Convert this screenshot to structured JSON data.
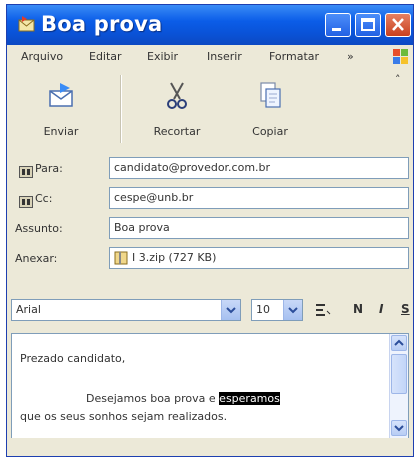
{
  "window": {
    "title": "Boa prova"
  },
  "menubar": {
    "items": [
      "Arquivo",
      "Editar",
      "Exibir",
      "Inserir",
      "Formatar"
    ],
    "overflow": "»"
  },
  "toolbar": {
    "send_label": "Enviar",
    "cut_label": "Recortar",
    "copy_label": "Copiar"
  },
  "header": {
    "to_label": "Para:",
    "to_value": "candidato@provedor.com.br",
    "cc_label": "Cc:",
    "cc_value": "cespe@unb.br",
    "subject_label": "Assunto:",
    "subject_value": "Boa prova",
    "attach_label": "Anexar:",
    "attach_value": "I 3.zip (727 KB)"
  },
  "format": {
    "font": "Arial",
    "size": "10",
    "bold": "N",
    "italic": "I",
    "underline": "S"
  },
  "message": {
    "line1": "Prezado candidato,",
    "line2_before": "Desejamos boa prova e ",
    "line2_highlight": "esperamos",
    "line3": "que os seus sonhos sejam realizados."
  },
  "colors": {
    "titlebar": "#0b5de8",
    "window_bg": "#ECE9D8",
    "highlight_bg": "#000000"
  }
}
